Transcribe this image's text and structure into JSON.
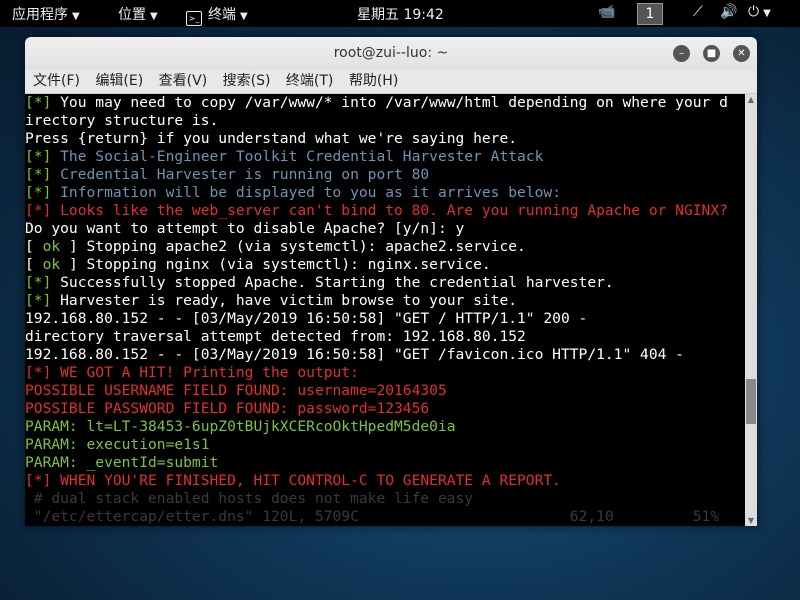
{
  "topbar": {
    "apps": "应用程序",
    "places": "位置",
    "terminal": "终端",
    "clock": "星期五 19:42",
    "workspace": "1"
  },
  "window": {
    "title": "root@zui--luo: ~"
  },
  "menu": [
    "文件(F)",
    "编辑(E)",
    "查看(V)",
    "搜索(S)",
    "终端(T)",
    "帮助(H)"
  ],
  "colors": {
    "green": "#7ec43a",
    "red": "#e0302c",
    "blue": "#6d93b5",
    "white": "#ffffff"
  },
  "lines": [
    [
      [
        "[*]",
        "green"
      ],
      [
        " You may need to copy /var/www/* into /var/www/html depending on where your d",
        "white"
      ]
    ],
    [
      [
        "irectory structure is.",
        "white"
      ]
    ],
    [
      [
        "Press {return} if you understand what we're saying here.",
        "white"
      ]
    ],
    [
      [
        "[*]",
        "green"
      ],
      [
        " The Social-Engineer Toolkit Credential Harvester Attack",
        "blue"
      ]
    ],
    [
      [
        "[*]",
        "green"
      ],
      [
        " Credential Harvester is running on port 80",
        "blue"
      ]
    ],
    [
      [
        "[*]",
        "green"
      ],
      [
        " Information will be displayed to you as it arrives below:",
        "blue"
      ]
    ],
    [
      [
        "[*] Looks like the web_server can't bind to 80. Are you running Apache or NGINX?",
        "red"
      ]
    ],
    [
      [
        "Do you want to attempt to disable Apache? [y/n]: y",
        "white"
      ]
    ],
    [
      [
        "[ ",
        "white"
      ],
      [
        "ok",
        "green"
      ],
      [
        " ] Stopping apache2 (via systemctl): apache2.service.",
        "white"
      ]
    ],
    [
      [
        "[ ",
        "white"
      ],
      [
        "ok",
        "green"
      ],
      [
        " ] Stopping nginx (via systemctl): nginx.service.",
        "white"
      ]
    ],
    [
      [
        "[*]",
        "green"
      ],
      [
        " Successfully stopped Apache. Starting the credential harvester.",
        "white"
      ]
    ],
    [
      [
        "[*]",
        "green"
      ],
      [
        " Harvester is ready, have victim browse to your site.",
        "white"
      ]
    ],
    [
      [
        "192.168.80.152 - - [03/May/2019 16:50:58] \"GET / HTTP/1.1\" 200 -",
        "white"
      ]
    ],
    [
      [
        "directory traversal attempt detected from: 192.168.80.152",
        "white"
      ]
    ],
    [
      [
        "192.168.80.152 - - [03/May/2019 16:50:58] \"GET /favicon.ico HTTP/1.1\" 404 -",
        "white"
      ]
    ],
    [
      [
        "[*] WE GOT A HIT! Printing the output:",
        "red"
      ]
    ],
    [
      [
        "POSSIBLE USERNAME FIELD FOUND: username=20164305",
        "red"
      ]
    ],
    [
      [
        "POSSIBLE PASSWORD FIELD FOUND: password=123456",
        "red"
      ]
    ],
    [
      [
        "PARAM: lt=LT-38453-6upZ0tBUjkXCERcoOktHpedM5de0ia",
        "green"
      ]
    ],
    [
      [
        "PARAM: execution=e1s1",
        "green"
      ]
    ],
    [
      [
        "PARAM: _eventId=submit",
        "green"
      ]
    ],
    [
      [
        "[*] WHEN YOU'RE FINISHED, HIT CONTROL-C TO GENERATE A REPORT.",
        "red"
      ]
    ],
    [
      [
        " # dual stack enabled hosts does not make life easy",
        "ghost"
      ]
    ],
    [
      [
        " \"/etc/ettercap/etter.dns\" 120L, 5709C                        62,10         51%",
        "ghost"
      ]
    ]
  ]
}
